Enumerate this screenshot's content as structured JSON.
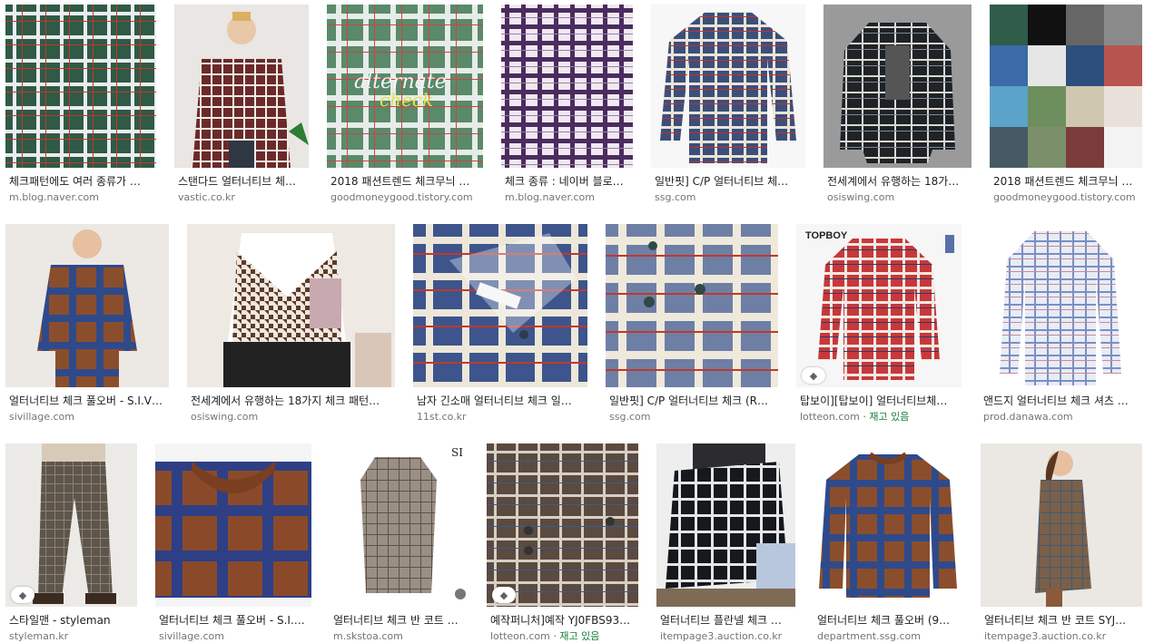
{
  "results": [
    {
      "title": "체크패턴에도 여러 종류가 …",
      "source": "m.blog.naver.com",
      "image": "check-fabric-green",
      "tag": false
    },
    {
      "title": "스탠다드 얼터너티브 체…",
      "source": "vastic.co.kr",
      "image": "man-check-shirt",
      "tag": false
    },
    {
      "title": "2018 패션트렌드 체크무늬 …",
      "source": "goodmoneygood.tistory.com",
      "image": "alternate-check-fabric",
      "tag": false
    },
    {
      "title": "체크 종류 : 네이버 블로…",
      "source": "m.blog.naver.com",
      "image": "purple-check-fabric",
      "tag": false
    },
    {
      "title": "일반핏] C/P 얼터너티브 체…",
      "source": "ssg.com",
      "image": "blue-check-shirt",
      "tag": false
    },
    {
      "title": "전세계에서 유행하는 18가…",
      "source": "osiswing.com",
      "image": "black-check-shirt",
      "tag": false
    },
    {
      "title": "2018 패션트렌드 체크무늬 …",
      "source": "goodmoneygood.tistory.com",
      "image": "check-types-grid",
      "tag": false
    },
    {
      "title": "얼터너티브 체크 풀오버 - S.I.V…",
      "source": "sivillage.com",
      "image": "woman-check-pullover",
      "tag": false
    },
    {
      "title": "전세계에서 유행하는 18가지 체크 패턴…",
      "source": "osiswing.com",
      "image": "houndstooth-vest",
      "tag": false
    },
    {
      "title": "남자 긴소매 얼터너티브 체크 일…",
      "source": "11st.co.kr",
      "image": "shirt-collar-closeup",
      "tag": false
    },
    {
      "title": "일반핏] C/P 얼터너티브 체크 (R…",
      "source": "ssg.com",
      "image": "shirt-cuff-closeup",
      "tag": false
    },
    {
      "title": "탑보이][탑보이] 얼터너티브체…",
      "source": "lotteon.com",
      "stock": "재고 있음",
      "image": "red-check-shirt",
      "tag": true
    },
    {
      "title": "앤드지 얼터너티브 체크 셔츠 …",
      "source": "prod.danawa.com",
      "image": "light-check-shirt",
      "tag": false
    },
    {
      "title": "스타일맨 - styleman",
      "source": "styleman.kr",
      "image": "check-trousers",
      "tag": true
    },
    {
      "title": "얼터너티브 체크 풀오버 - S.I.…",
      "source": "sivillage.com",
      "image": "sweater-closeup",
      "tag": false
    },
    {
      "title": "얼터너티브 체크 반 코트 …",
      "source": "m.skstoa.com",
      "image": "check-coat",
      "tag": false
    },
    {
      "title": "예작퍼니처]예작 YJ0FBS93…",
      "source": "lotteon.com",
      "stock": "재고 있음",
      "image": "cuff-button-closeup",
      "tag": true
    },
    {
      "title": "얼터너티브 플란넬 체크 …",
      "source": "itempage3.auction.co.kr",
      "image": "flannel-check-folded",
      "tag": false
    },
    {
      "title": "얼터너티브 체크 풀오버 (9…",
      "source": "department.ssg.com",
      "image": "check-pullover-flat",
      "tag": false
    },
    {
      "title": "얼터너티브 체크 반 코트 SYJ…",
      "source": "itempage3.auction.co.kr",
      "image": "woman-check-coat",
      "tag": false
    }
  ]
}
